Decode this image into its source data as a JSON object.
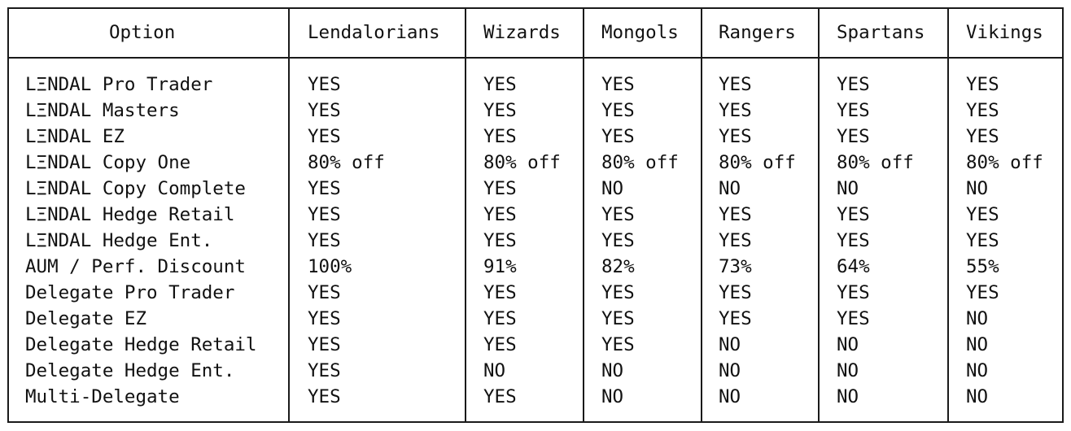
{
  "table": {
    "headers": [
      "Option",
      "Lendalorians",
      "Wizards",
      "Mongols",
      "Rangers",
      "Spartans",
      "Vikings"
    ],
    "rows": [
      [
        "LΞNDAL Pro Trader",
        "YES",
        "YES",
        "YES",
        "YES",
        "YES",
        "YES"
      ],
      [
        "LΞNDAL Masters",
        "YES",
        "YES",
        "YES",
        "YES",
        "YES",
        "YES"
      ],
      [
        "LΞNDAL EZ",
        "YES",
        "YES",
        "YES",
        "YES",
        "YES",
        "YES"
      ],
      [
        "LΞNDAL Copy One",
        "80% off",
        "80% off",
        "80% off",
        "80% off",
        "80% off",
        "80% off"
      ],
      [
        "LΞNDAL Copy Complete",
        "YES",
        "YES",
        "NO",
        "NO",
        "NO",
        "NO"
      ],
      [
        "LΞNDAL Hedge Retail",
        "YES",
        "YES",
        "YES",
        "YES",
        "YES",
        "YES"
      ],
      [
        "LΞNDAL Hedge Ent.",
        "YES",
        "YES",
        "YES",
        "YES",
        "YES",
        "YES"
      ],
      [
        "AUM / Perf. Discount",
        "100%",
        "91%",
        "82%",
        "73%",
        "64%",
        "55%"
      ],
      [
        "Delegate Pro Trader",
        "YES",
        "YES",
        "YES",
        "YES",
        "YES",
        "YES"
      ],
      [
        "Delegate EZ",
        "YES",
        "YES",
        "YES",
        "YES",
        "YES",
        "NO"
      ],
      [
        "Delegate Hedge Retail",
        "YES",
        "YES",
        "YES",
        "NO",
        "NO",
        "NO"
      ],
      [
        "Delegate Hedge Ent.",
        "YES",
        "NO",
        "NO",
        "NO",
        "NO",
        "NO"
      ],
      [
        "Multi-Delegate",
        "YES",
        "YES",
        "NO",
        "NO",
        "NO",
        "NO"
      ]
    ]
  }
}
